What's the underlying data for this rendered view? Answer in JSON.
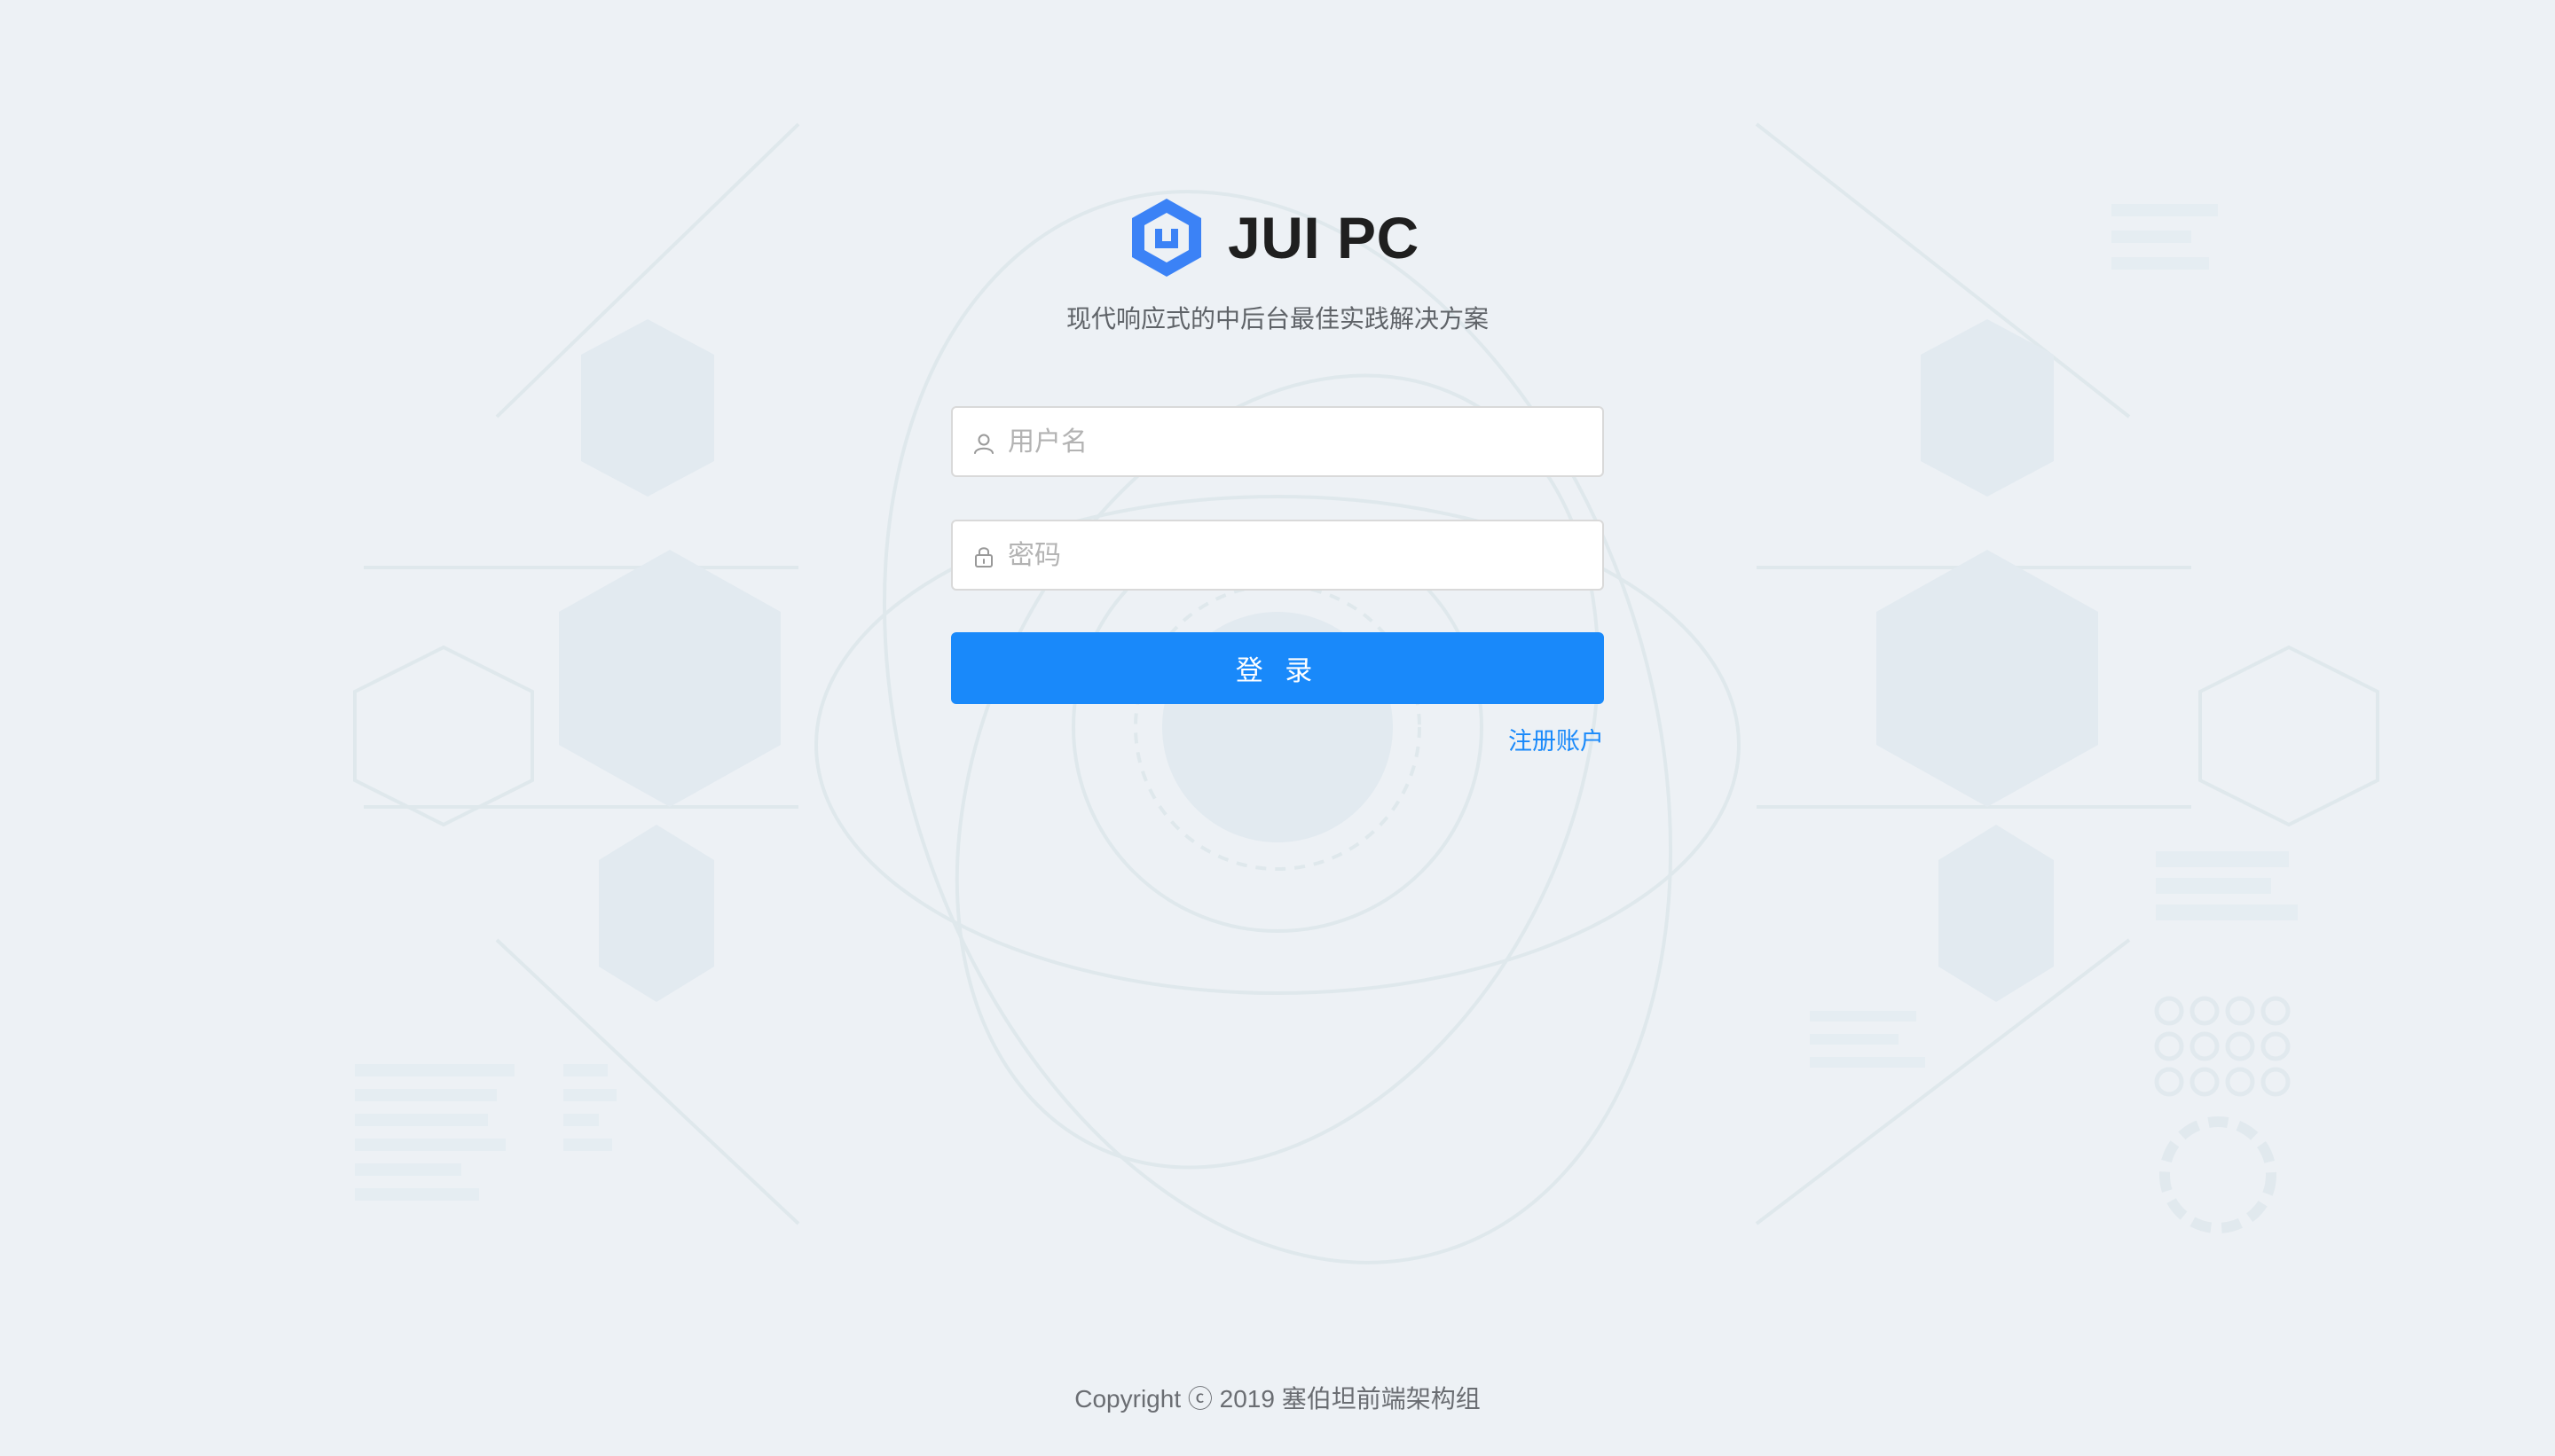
{
  "brand": {
    "logo_icon": "hexagon-logo-icon",
    "name": "JUI PC",
    "tagline": "现代响应式的中后台最佳实践解决方案",
    "accent_color": "#3b82f6"
  },
  "form": {
    "username": {
      "icon": "user-icon",
      "placeholder": "用户名",
      "value": ""
    },
    "password": {
      "icon": "lock-icon",
      "placeholder": "密码",
      "value": ""
    },
    "login_label": "登 录",
    "register_label": "注册账户",
    "primary_color": "#1989fa"
  },
  "footer": {
    "copyright": "Copyright ⓒ 2019 塞伯坦前端架构组"
  }
}
